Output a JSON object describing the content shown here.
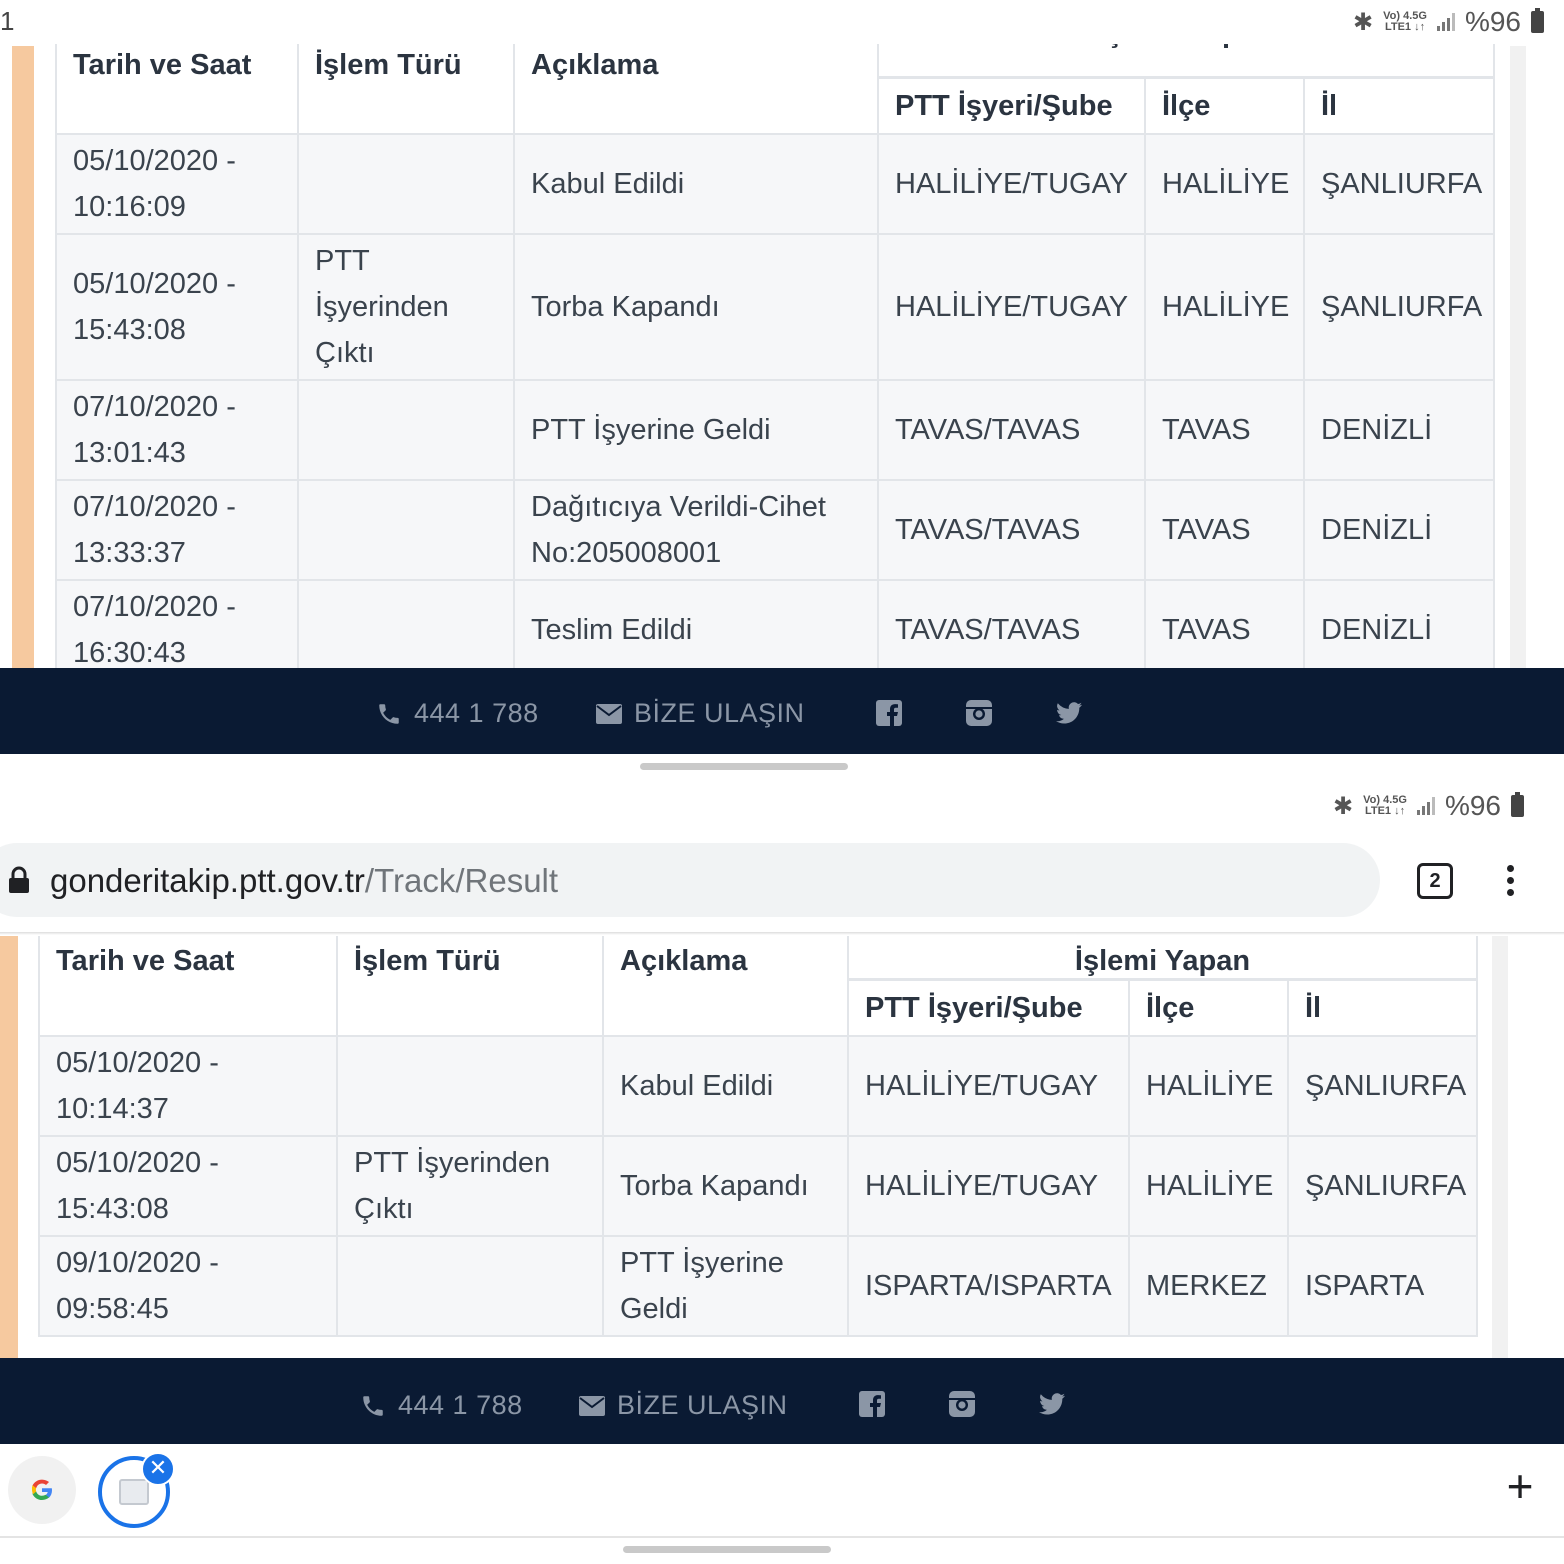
{
  "top_status": {
    "left_text": "1",
    "network_top": "Vo) 4.5G",
    "network_bottom": "LTE1 ↓↑",
    "battery_text": "%96"
  },
  "bottom_status": {
    "network_top": "Vo) 4.5G",
    "network_bottom": "LTE1 ↓↑",
    "battery_text": "%96"
  },
  "browser": {
    "url_domain": "gonderitakip.ptt.gov.tr",
    "url_path": "/Track/Result",
    "tab_count": "2"
  },
  "table_headers": {
    "date": "Tarih ve Saat",
    "type": "İşlem Türü",
    "desc": "Açıklama",
    "group_bottom": "İşlemi Yapan",
    "branch": "PTT İşyeri/Şube",
    "district": "İlçe",
    "province": "İl"
  },
  "top_table": {
    "rows": [
      {
        "date1": "05/10/2020 -",
        "date2": "10:16:09",
        "type": "",
        "desc": "Kabul Edildi",
        "branch": "HALİLİYE/TUGAY",
        "district": "HALİLİYE",
        "province": "ŞANLIURFA"
      },
      {
        "date1": "05/10/2020 -",
        "date2": "15:43:08",
        "type": "PTT İşyerinden Çıktı",
        "desc": "Torba Kapandı",
        "branch": "HALİLİYE/TUGAY",
        "district": "HALİLİYE",
        "province": "ŞANLIURFA"
      },
      {
        "date1": "07/10/2020 -",
        "date2": "13:01:43",
        "type": "",
        "desc": "PTT İşyerine Geldi",
        "branch": "TAVAS/TAVAS",
        "district": "TAVAS",
        "province": "DENİZLİ"
      },
      {
        "date1": "07/10/2020 -",
        "date2": "13:33:37",
        "type": "",
        "desc": "Dağıtıcıya Verildi-Cihet No:205008001",
        "branch": "TAVAS/TAVAS",
        "district": "TAVAS",
        "province": "DENİZLİ"
      },
      {
        "date1": "07/10/2020 -",
        "date2": "16:30:43",
        "type": "",
        "desc": "Teslim Edildi",
        "branch": "TAVAS/TAVAS",
        "district": "TAVAS",
        "province": "DENİZLİ"
      }
    ]
  },
  "bottom_table": {
    "rows": [
      {
        "date1": "05/10/2020 -",
        "date2": "10:14:37",
        "type": "",
        "desc": "Kabul Edildi",
        "branch": "HALİLİYE/TUGAY",
        "district": "HALİLİYE",
        "province": "ŞANLIURFA"
      },
      {
        "date1": "05/10/2020 -",
        "date2": "15:43:08",
        "type": "PTT İşyerinden Çıktı",
        "desc": "Torba Kapandı",
        "branch": "HALİLİYE/TUGAY",
        "district": "HALİLİYE",
        "province": "ŞANLIURFA"
      },
      {
        "date1": "09/10/2020 -",
        "date2": "09:58:45",
        "type": "",
        "desc": "PTT İşyerine Geldi",
        "branch": "ISPARTA/ISPARTA",
        "district": "MERKEZ",
        "province": "ISPARTA"
      }
    ]
  },
  "footer": {
    "phone": "444 1 788",
    "contact": "BİZE ULAŞIN"
  },
  "icons": {
    "phone": "phone-icon",
    "mail": "mail-icon",
    "facebook": "facebook-icon",
    "instagram": "instagram-icon",
    "twitter": "twitter-icon",
    "lock": "lock-icon",
    "google": "google-icon",
    "close": "close-icon",
    "add": "plus-icon"
  },
  "colors": {
    "footer_bg": "#0a1a33",
    "accent": "#f6c99f",
    "close_badge": "#1a73e8"
  }
}
